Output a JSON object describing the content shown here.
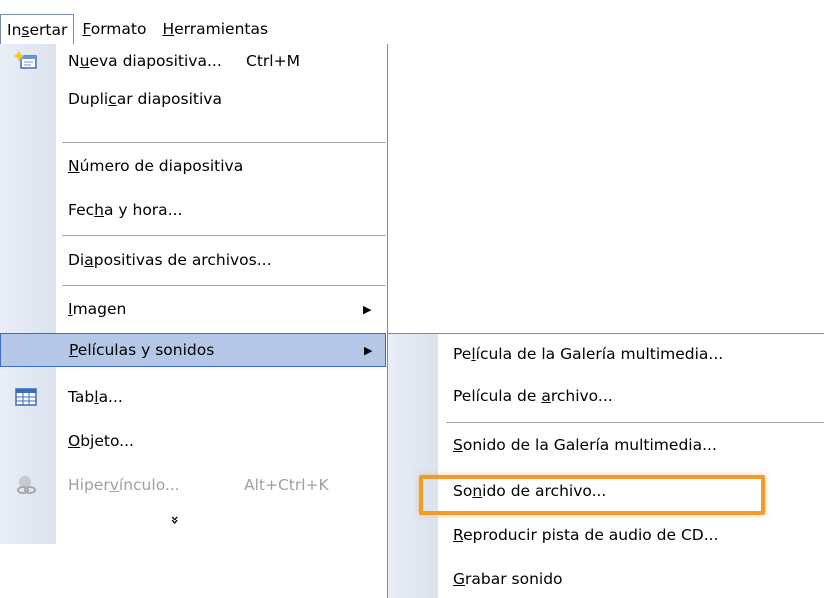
{
  "menubar": {
    "insert": {
      "pre": "In",
      "u": "s",
      "post": "ertar"
    },
    "format": {
      "pre": "",
      "u": "F",
      "post": "ormato"
    },
    "tools": {
      "pre": "",
      "u": "H",
      "post": "erramientas"
    }
  },
  "menu": {
    "new_slide": {
      "pre": "N",
      "u": "u",
      "post": "eva diapositiva...",
      "shortcut": "Ctrl+M"
    },
    "duplicate": {
      "pre": "Dupli",
      "u": "c",
      "post": "ar diapositiva"
    },
    "slide_number": {
      "pre": "",
      "u": "N",
      "post": "úmero de diapositiva"
    },
    "date_time": {
      "pre": "Fec",
      "u": "h",
      "post": "a y hora..."
    },
    "slides_from_files": {
      "pre": "Di",
      "u": "a",
      "post": "positivas de archivos..."
    },
    "picture": {
      "pre": "",
      "u": "I",
      "post": "magen"
    },
    "movies_sounds": {
      "pre": "",
      "u": "P",
      "post": "elículas y sonidos"
    },
    "table": {
      "pre": "Tab",
      "u": "l",
      "post": "a..."
    },
    "object": {
      "pre": "",
      "u": "O",
      "post": "bjeto..."
    },
    "hyperlink": {
      "pre": "Hiper",
      "u": "v",
      "post": "ínculo...",
      "shortcut": "Alt+Ctrl+K"
    },
    "expand": "»"
  },
  "submenu": {
    "movie_gallery": {
      "pre": "Pe",
      "u": "l",
      "post": "ícula de la Galería multimedia..."
    },
    "movie_file": {
      "pre": "Película de ",
      "u": "a",
      "post": "rchivo..."
    },
    "sound_gallery": {
      "pre": "",
      "u": "S",
      "post": "onido de la Galería multimedia..."
    },
    "sound_file": {
      "pre": "So",
      "u": "n",
      "post": "ido de archivo..."
    },
    "cd_audio": {
      "pre": "",
      "u": "R",
      "post": "eproducir pista de audio de CD..."
    },
    "record_sound": {
      "pre": "",
      "u": "G",
      "post": "rabar sonido"
    }
  },
  "colors": {
    "highlight_border": "#f39a2b",
    "selected_bg": "#b5c7e6",
    "selected_border": "#3b6bc2"
  }
}
